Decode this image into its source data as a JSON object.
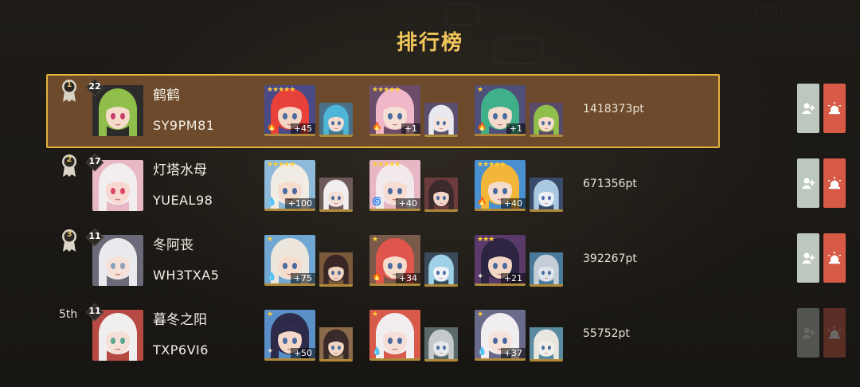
{
  "page": {
    "title": "排行榜"
  },
  "rows": [
    {
      "rank_label": "1",
      "rank_style": "medal",
      "highlight": true,
      "level": "22",
      "name": "鹤鹤",
      "player_id": "SY9PM81",
      "score": "1418373pt",
      "avatar": {
        "hair": "#8fbf4a",
        "skin": "#f6dccb",
        "eye": "#c73d6b",
        "bg": "#2b2b2b"
      },
      "teams": [
        {
          "stars": "★★★★★",
          "element_icon": "fire-icon",
          "element": "🔥",
          "plus": "+45",
          "main": {
            "hair": "#e8413a",
            "skin": "#f4d6c4",
            "bg": "#4a4a86"
          },
          "sub": {
            "hair": "#4fb5d6",
            "skin": "#f3dccd",
            "bg": "#4a6f88"
          }
        },
        {
          "stars": "★★★★★",
          "element_icon": "fire-icon",
          "element": "🔥",
          "plus": "+1",
          "main": {
            "hair": "#f0b7c9",
            "skin": "#f6e0d5",
            "bg": "#6b4d6a"
          },
          "sub": {
            "hair": "#e8e8ee",
            "skin": "#f5e4dc",
            "bg": "#5b4d6e"
          }
        },
        {
          "stars": "★",
          "element_icon": "fire-icon",
          "element": "🔥",
          "plus": "+1",
          "main": {
            "hair": "#3fb08a",
            "skin": "#f3dccd",
            "bg": "#4f4f7a"
          },
          "sub": {
            "hair": "#8fbf4a",
            "skin": "#f6dccb",
            "bg": "#5a4a6a"
          }
        }
      ]
    },
    {
      "rank_label": "2",
      "rank_style": "medal",
      "highlight": false,
      "level": "17",
      "name": "灯塔水母",
      "player_id": "YUEAL98",
      "score": "671356pt",
      "avatar": {
        "hair": "#f2eef0",
        "skin": "#f7d9d2",
        "eye": "#d9486c",
        "bg": "#e8b8c4"
      },
      "teams": [
        {
          "stars": "★★★★★",
          "element_icon": "water-icon",
          "element": "💧",
          "plus": "+100",
          "main": {
            "hair": "#f1ece4",
            "skin": "#f6dccd",
            "bg": "#8fb9d8"
          },
          "sub": {
            "hair": "#f2eef0",
            "skin": "#f5dfd5",
            "bg": "#6e5a5a"
          }
        },
        {
          "stars": "★★★★★",
          "element_icon": "spiral-icon",
          "element": "🌀",
          "plus": "+40",
          "main": {
            "hair": "#f1e9ec",
            "skin": "#f7dcd2",
            "bg": "#e7b8c4"
          },
          "sub": {
            "hair": "#3a2a2c",
            "skin": "#f4d6c9",
            "bg": "#6c3c3c"
          }
        },
        {
          "stars": "★★★★★",
          "element_icon": "fire-icon",
          "element": "🔥",
          "plus": "+40",
          "main": {
            "hair": "#f2b63a",
            "skin": "#f6dccb",
            "bg": "#4a8fd0"
          },
          "sub": {
            "hair": "#a9c8e2",
            "skin": "#eef0f5",
            "bg": "#3a4a6a"
          }
        }
      ]
    },
    {
      "rank_label": "3",
      "rank_style": "medal",
      "highlight": false,
      "level": "11",
      "name": "冬阿丧",
      "player_id": "WH3TXA5",
      "score": "392267pt",
      "avatar": {
        "hair": "#e9e9ee",
        "skin": "#f5e1d8",
        "eye": "#8a9fb8",
        "bg": "#6a6a78"
      },
      "teams": [
        {
          "stars": "★",
          "element_icon": "water-icon",
          "element": "💧",
          "plus": "+75",
          "main": {
            "hair": "#ece6dc",
            "skin": "#f6dccd",
            "bg": "#6fa7d2"
          },
          "sub": {
            "hair": "#3a2724",
            "skin": "#f2d3c0",
            "bg": "#7a5a3a"
          }
        },
        {
          "stars": "★",
          "element_icon": "fire-icon",
          "element": "🔥",
          "plus": "+34",
          "main": {
            "hair": "#e0564c",
            "skin": "#f6dccb",
            "bg": "#7a5a4a"
          },
          "sub": {
            "hair": "#9fd1e8",
            "skin": "#eef2f5",
            "bg": "#3a4a5a"
          }
        },
        {
          "stars": "★★★",
          "element_icon": "spark-icon",
          "element": "✦",
          "plus": "+21",
          "main": {
            "hair": "#2c2440",
            "skin": "#f4d6c6",
            "bg": "#5a3a6a"
          },
          "sub": {
            "hair": "#c5cdd6",
            "skin": "#dfe5ea",
            "bg": "#4a7a9a"
          }
        }
      ]
    },
    {
      "rank_label": "5th",
      "rank_style": "text",
      "highlight": false,
      "level": "11",
      "name": "暮冬之阳",
      "player_id": "TXP6VI6",
      "score": "55752pt",
      "avatar": {
        "hair": "#f1eef0",
        "skin": "#f5dfd6",
        "eye": "#5aa690",
        "bg": "#b84a44"
      },
      "teams": [
        {
          "stars": "★",
          "element_icon": "spark-icon",
          "element": "✦",
          "plus": "+50",
          "main": {
            "hair": "#2d2a4a",
            "skin": "#f5d9c8",
            "bg": "#5a8fc8"
          },
          "sub": {
            "hair": "#3a2a2a",
            "skin": "#f3d6c4",
            "bg": "#8a6a4a"
          }
        },
        {
          "stars": "★",
          "element_icon": "water-icon",
          "element": "💧",
          "plus": "",
          "main": {
            "hair": "#f2eef0",
            "skin": "#f6dfd6",
            "bg": "#d75a4a"
          },
          "sub": {
            "hair": "#c5c9cc",
            "skin": "#e7e9ea",
            "bg": "#5a6a6a"
          }
        },
        {
          "stars": "★",
          "element_icon": "water-icon",
          "element": "💧",
          "plus": "+37",
          "main": {
            "hair": "#f1eef2",
            "skin": "#f5e2da",
            "bg": "#6a6a8a"
          },
          "sub": {
            "hair": "#e9e6df",
            "skin": "#f0efe9",
            "bg": "#5a8aa0"
          }
        }
      ]
    }
  ],
  "actions": {
    "add_friend_icon": "add-friend-icon",
    "report_icon": "alarm-icon"
  },
  "colors": {
    "accent": "#f1c75b",
    "highlight_bg": "#6e4a2c",
    "highlight_border": "#e3b23c",
    "add_btn": "#bcc7bd",
    "alarm_btn": "#d75a46"
  }
}
